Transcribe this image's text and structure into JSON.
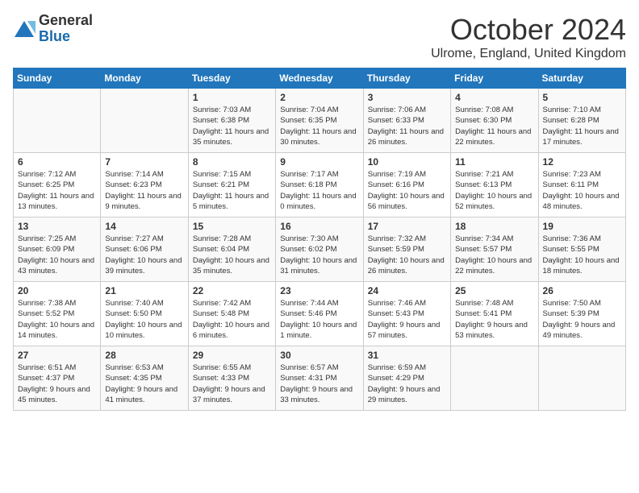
{
  "logo": {
    "general": "General",
    "blue": "Blue"
  },
  "title": "October 2024",
  "location": "Ulrome, England, United Kingdom",
  "days_header": [
    "Sunday",
    "Monday",
    "Tuesday",
    "Wednesday",
    "Thursday",
    "Friday",
    "Saturday"
  ],
  "weeks": [
    [
      {
        "num": "",
        "info": ""
      },
      {
        "num": "",
        "info": ""
      },
      {
        "num": "1",
        "info": "Sunrise: 7:03 AM\nSunset: 6:38 PM\nDaylight: 11 hours and 35 minutes."
      },
      {
        "num": "2",
        "info": "Sunrise: 7:04 AM\nSunset: 6:35 PM\nDaylight: 11 hours and 30 minutes."
      },
      {
        "num": "3",
        "info": "Sunrise: 7:06 AM\nSunset: 6:33 PM\nDaylight: 11 hours and 26 minutes."
      },
      {
        "num": "4",
        "info": "Sunrise: 7:08 AM\nSunset: 6:30 PM\nDaylight: 11 hours and 22 minutes."
      },
      {
        "num": "5",
        "info": "Sunrise: 7:10 AM\nSunset: 6:28 PM\nDaylight: 11 hours and 17 minutes."
      }
    ],
    [
      {
        "num": "6",
        "info": "Sunrise: 7:12 AM\nSunset: 6:25 PM\nDaylight: 11 hours and 13 minutes."
      },
      {
        "num": "7",
        "info": "Sunrise: 7:14 AM\nSunset: 6:23 PM\nDaylight: 11 hours and 9 minutes."
      },
      {
        "num": "8",
        "info": "Sunrise: 7:15 AM\nSunset: 6:21 PM\nDaylight: 11 hours and 5 minutes."
      },
      {
        "num": "9",
        "info": "Sunrise: 7:17 AM\nSunset: 6:18 PM\nDaylight: 11 hours and 0 minutes."
      },
      {
        "num": "10",
        "info": "Sunrise: 7:19 AM\nSunset: 6:16 PM\nDaylight: 10 hours and 56 minutes."
      },
      {
        "num": "11",
        "info": "Sunrise: 7:21 AM\nSunset: 6:13 PM\nDaylight: 10 hours and 52 minutes."
      },
      {
        "num": "12",
        "info": "Sunrise: 7:23 AM\nSunset: 6:11 PM\nDaylight: 10 hours and 48 minutes."
      }
    ],
    [
      {
        "num": "13",
        "info": "Sunrise: 7:25 AM\nSunset: 6:09 PM\nDaylight: 10 hours and 43 minutes."
      },
      {
        "num": "14",
        "info": "Sunrise: 7:27 AM\nSunset: 6:06 PM\nDaylight: 10 hours and 39 minutes."
      },
      {
        "num": "15",
        "info": "Sunrise: 7:28 AM\nSunset: 6:04 PM\nDaylight: 10 hours and 35 minutes."
      },
      {
        "num": "16",
        "info": "Sunrise: 7:30 AM\nSunset: 6:02 PM\nDaylight: 10 hours and 31 minutes."
      },
      {
        "num": "17",
        "info": "Sunrise: 7:32 AM\nSunset: 5:59 PM\nDaylight: 10 hours and 26 minutes."
      },
      {
        "num": "18",
        "info": "Sunrise: 7:34 AM\nSunset: 5:57 PM\nDaylight: 10 hours and 22 minutes."
      },
      {
        "num": "19",
        "info": "Sunrise: 7:36 AM\nSunset: 5:55 PM\nDaylight: 10 hours and 18 minutes."
      }
    ],
    [
      {
        "num": "20",
        "info": "Sunrise: 7:38 AM\nSunset: 5:52 PM\nDaylight: 10 hours and 14 minutes."
      },
      {
        "num": "21",
        "info": "Sunrise: 7:40 AM\nSunset: 5:50 PM\nDaylight: 10 hours and 10 minutes."
      },
      {
        "num": "22",
        "info": "Sunrise: 7:42 AM\nSunset: 5:48 PM\nDaylight: 10 hours and 6 minutes."
      },
      {
        "num": "23",
        "info": "Sunrise: 7:44 AM\nSunset: 5:46 PM\nDaylight: 10 hours and 1 minute."
      },
      {
        "num": "24",
        "info": "Sunrise: 7:46 AM\nSunset: 5:43 PM\nDaylight: 9 hours and 57 minutes."
      },
      {
        "num": "25",
        "info": "Sunrise: 7:48 AM\nSunset: 5:41 PM\nDaylight: 9 hours and 53 minutes."
      },
      {
        "num": "26",
        "info": "Sunrise: 7:50 AM\nSunset: 5:39 PM\nDaylight: 9 hours and 49 minutes."
      }
    ],
    [
      {
        "num": "27",
        "info": "Sunrise: 6:51 AM\nSunset: 4:37 PM\nDaylight: 9 hours and 45 minutes."
      },
      {
        "num": "28",
        "info": "Sunrise: 6:53 AM\nSunset: 4:35 PM\nDaylight: 9 hours and 41 minutes."
      },
      {
        "num": "29",
        "info": "Sunrise: 6:55 AM\nSunset: 4:33 PM\nDaylight: 9 hours and 37 minutes."
      },
      {
        "num": "30",
        "info": "Sunrise: 6:57 AM\nSunset: 4:31 PM\nDaylight: 9 hours and 33 minutes."
      },
      {
        "num": "31",
        "info": "Sunrise: 6:59 AM\nSunset: 4:29 PM\nDaylight: 9 hours and 29 minutes."
      },
      {
        "num": "",
        "info": ""
      },
      {
        "num": "",
        "info": ""
      }
    ]
  ]
}
